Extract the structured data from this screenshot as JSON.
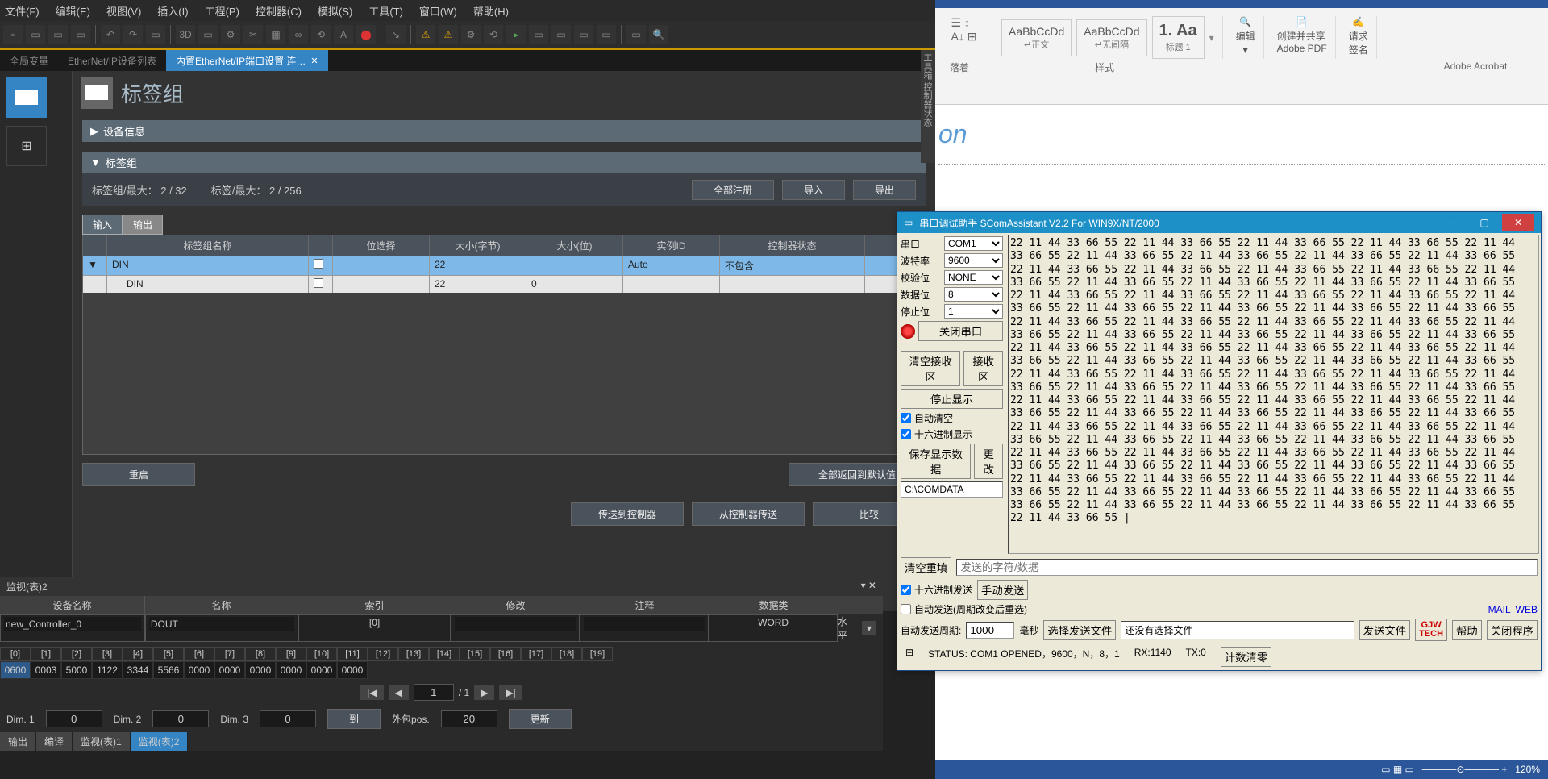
{
  "ide": {
    "menu": [
      "文件(F)",
      "编辑(E)",
      "视图(V)",
      "插入(I)",
      "工程(P)",
      "控制器(C)",
      "模拟(S)",
      "工具(T)",
      "窗口(W)",
      "帮助(H)"
    ],
    "tabs": [
      {
        "label": "全局变量",
        "active": false
      },
      {
        "label": "EtherNet/IP设备列表",
        "active": false
      },
      {
        "label": "内置EtherNet/IP端口设置 连…",
        "active": true
      }
    ],
    "header": "标签组",
    "panels": {
      "dev": "设备信息",
      "tag": "标签组"
    },
    "tagInfo": {
      "left": "标签组/最大：  2   /  32",
      "right": "标签/最大：  2   /   256"
    },
    "btns": {
      "regAll": "全部注册",
      "import": "导入",
      "export": "导出",
      "restart": "重启",
      "revert": "全部返回到默认值",
      "toCtrl": "传送到控制器",
      "fromCtrl": "从控制器传送",
      "compare": "比较"
    },
    "ioTabs": {
      "in": "输入",
      "out": "输出"
    },
    "cols": [
      "",
      "标签组名称",
      "",
      "位选择",
      "大小(字节)",
      "大小(位)",
      "实例ID",
      "控制器状态",
      ""
    ],
    "rows": [
      {
        "exp": "▼",
        "name": "DIN",
        "chk": "",
        "bit": "",
        "bytes": "22",
        "bits": "",
        "inst": "Auto",
        "ctrl": "不包含"
      },
      {
        "exp": "",
        "name": "DIN",
        "chk": "",
        "bit": "",
        "bytes": "22",
        "bits": "0",
        "inst": "",
        "ctrl": ""
      }
    ],
    "rightStrip": "工具箱  控制器状态"
  },
  "watch": {
    "title": "监视(表)2",
    "cols": [
      "设备名称",
      "名称",
      "索引",
      "修改",
      "注释",
      "数据类"
    ],
    "row": {
      "dev": "new_Controller_0",
      "name": "DOUT",
      "idx": "[0]",
      "mod": "",
      "cmt": "",
      "dtype": "WORD"
    },
    "level": "水平",
    "memHdr": [
      "[0]",
      "[1]",
      "[2]",
      "[3]",
      "[4]",
      "[5]",
      "[6]",
      "[7]",
      "[8]",
      "[9]",
      "[10]",
      "[11]",
      "[12]",
      "[13]",
      "[14]",
      "[15]",
      "[16]",
      "[17]",
      "[18]",
      "[19]"
    ],
    "memVals": [
      "0600",
      "0003",
      "5000",
      "1122",
      "3344",
      "5566",
      "0000",
      "0000",
      "0000",
      "0000",
      "0000",
      "0000"
    ],
    "page": "1",
    "pages": "/ 1",
    "dims": {
      "d1": "Dim. 1",
      "d1v": "0",
      "d2": "Dim. 2",
      "d2v": "0",
      "d3": "Dim. 3",
      "d3v": "0",
      "to": "到",
      "pos": "外包pos.",
      "posv": "20",
      "upd": "更新"
    },
    "bottomTabs": [
      "输出",
      "编译",
      "监视(表)1",
      "监视(表)2"
    ]
  },
  "word": {
    "styles": [
      {
        "txt": "AaBbCcDd",
        "lbl": "↵正文"
      },
      {
        "txt": "AaBbCcDd",
        "lbl": "↵无间隔"
      },
      {
        "txt": "1. Aa",
        "lbl": "标题 1"
      }
    ],
    "groups": {
      "para": "落着",
      "style": "样式",
      "edit": "编辑",
      "pdf": "创建并共享\nAdobe PDF",
      "sig": "请求\n签名",
      "acro": "Adobe Acrobat"
    },
    "docText": "on",
    "zoom": "120%"
  },
  "serial": {
    "title": "串口调试助手 SComAssistant V2.2 For WIN9X/NT/2000",
    "labels": {
      "port": "串口",
      "baud": "波特率",
      "parity": "校验位",
      "data": "数据位",
      "stop": "停止位"
    },
    "vals": {
      "port": "COM1",
      "baud": "9600",
      "parity": "NONE",
      "data": "8",
      "stop": "1"
    },
    "btns": {
      "close": "关闭串口",
      "clrRx": "清空接收区",
      "rxArea": "接收区",
      "stopShow": "停止显示",
      "saveShow": "保存显示数据",
      "change": "更改",
      "clrRefill": "清空重填",
      "sendChars": "发送的字符/数据",
      "manual": "手动发送",
      "selFile": "选择发送文件",
      "noFile": "还没有选择文件",
      "sendFile": "发送文件",
      "help": "帮助",
      "closeProg": "关闭程序",
      "countClr": "计数清零"
    },
    "chks": {
      "autoClr": "自动清空",
      "hexShow": "十六进制显示",
      "hexSend": "十六进制发送",
      "autoSend": "自动发送(周期改变后重选)"
    },
    "path": "C:\\COMDATA",
    "sendPeriod": {
      "lbl": "自动发送周期:",
      "val": "1000",
      "unit": "毫秒"
    },
    "links": {
      "mail": "MAIL",
      "web": "WEB"
    },
    "logo": {
      "l1": "GJW",
      "l2": "TECH"
    },
    "status": {
      "st": "STATUS: COM1 OPENED，9600，N，8，1",
      "rx": "RX:1140",
      "tx": "TX:0"
    },
    "log": "22 11 44 33 66 55 22 11 44 33 66 55 22 11 44 33 66 55 22 11 44 33 66 55 22 11 44\n33 66 55 22 11 44 33 66 55 22 11 44 33 66 55 22 11 44 33 66 55 22 11 44 33 66 55\n22 11 44 33 66 55 22 11 44 33 66 55 22 11 44 33 66 55 22 11 44 33 66 55 22 11 44\n33 66 55 22 11 44 33 66 55 22 11 44 33 66 55 22 11 44 33 66 55 22 11 44 33 66 55\n22 11 44 33 66 55 22 11 44 33 66 55 22 11 44 33 66 55 22 11 44 33 66 55 22 11 44\n33 66 55 22 11 44 33 66 55 22 11 44 33 66 55 22 11 44 33 66 55 22 11 44 33 66 55\n22 11 44 33 66 55 22 11 44 33 66 55 22 11 44 33 66 55 22 11 44 33 66 55 22 11 44\n33 66 55 22 11 44 33 66 55 22 11 44 33 66 55 22 11 44 33 66 55 22 11 44 33 66 55\n22 11 44 33 66 55 22 11 44 33 66 55 22 11 44 33 66 55 22 11 44 33 66 55 22 11 44\n33 66 55 22 11 44 33 66 55 22 11 44 33 66 55 22 11 44 33 66 55 22 11 44 33 66 55\n22 11 44 33 66 55 22 11 44 33 66 55 22 11 44 33 66 55 22 11 44 33 66 55 22 11 44\n33 66 55 22 11 44 33 66 55 22 11 44 33 66 55 22 11 44 33 66 55 22 11 44 33 66 55\n22 11 44 33 66 55 22 11 44 33 66 55 22 11 44 33 66 55 22 11 44 33 66 55 22 11 44\n33 66 55 22 11 44 33 66 55 22 11 44 33 66 55 22 11 44 33 66 55 22 11 44 33 66 55\n22 11 44 33 66 55 22 11 44 33 66 55 22 11 44 33 66 55 22 11 44 33 66 55 22 11 44\n33 66 55 22 11 44 33 66 55 22 11 44 33 66 55 22 11 44 33 66 55 22 11 44 33 66 55\n22 11 44 33 66 55 22 11 44 33 66 55 22 11 44 33 66 55 22 11 44 33 66 55 22 11 44\n33 66 55 22 11 44 33 66 55 22 11 44 33 66 55 22 11 44 33 66 55 22 11 44 33 66 55\n22 11 44 33 66 55 22 11 44 33 66 55 22 11 44 33 66 55 22 11 44 33 66 55 22 11 44\n33 66 55 22 11 44 33 66 55 22 11 44 33 66 55 22 11 44 33 66 55 22 11 44 33 66 55\n33 66 55 22 11 44 33 66 55 22 11 44 33 66 55 22 11 44 33 66 55 22 11 44 33 66 55\n22 11 44 33 66 55 |"
  }
}
